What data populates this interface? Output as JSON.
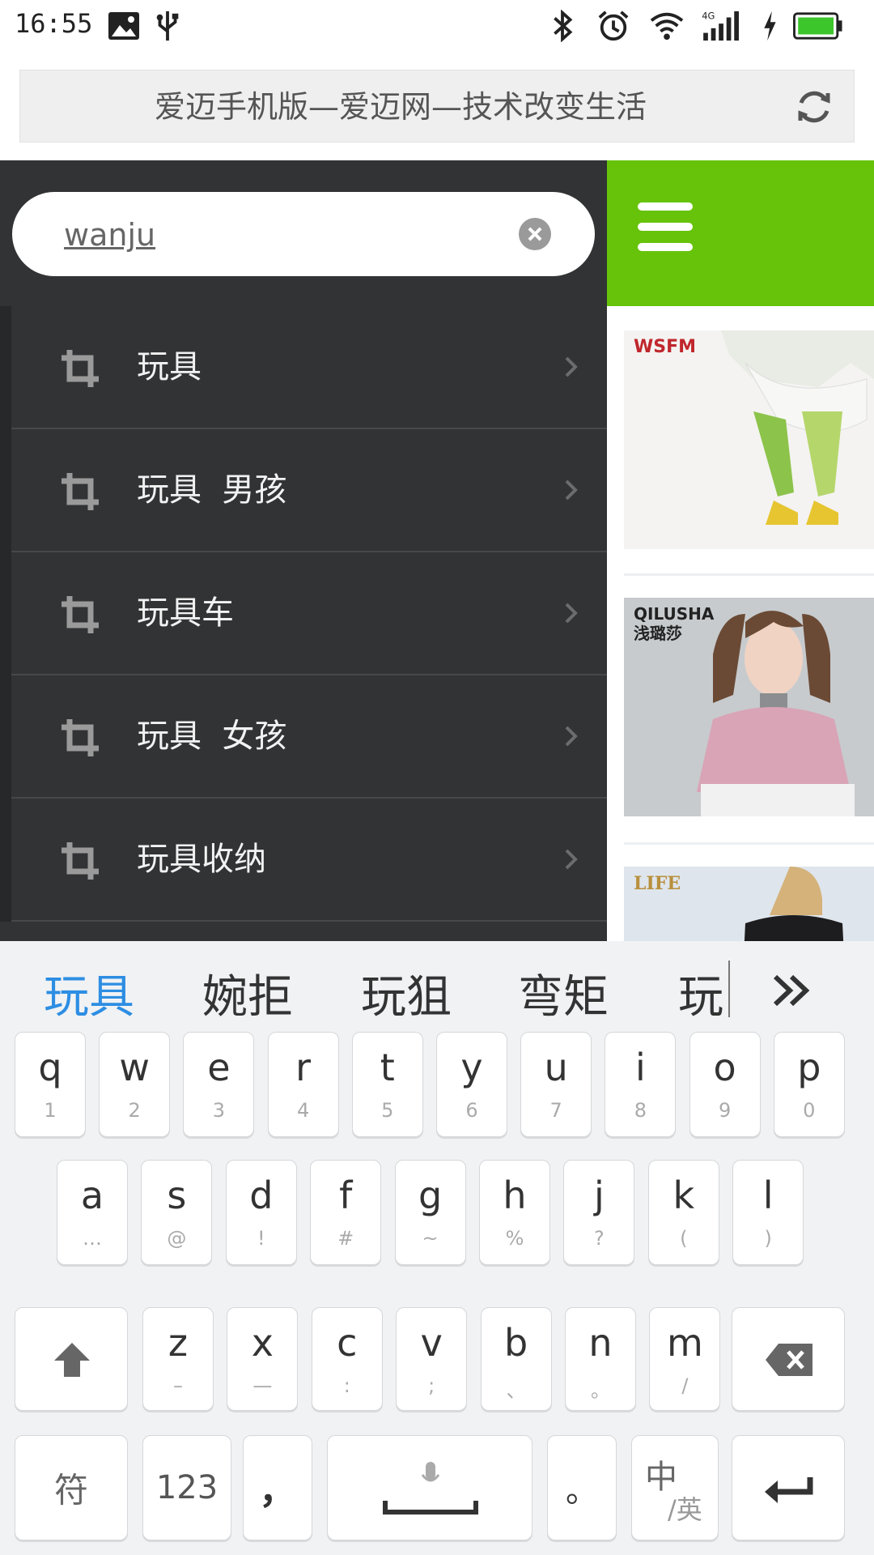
{
  "status_bar": {
    "time": "16:55",
    "battery_color": "#3dc52c"
  },
  "url_bar": {
    "title": "爱迈手机版—爱迈网—技术改变生活"
  },
  "search": {
    "value": "wanju"
  },
  "suggestions": [
    {
      "label": "玩具"
    },
    {
      "label": "玩具  男孩"
    },
    {
      "label": "玩具车"
    },
    {
      "label": "玩具  女孩"
    },
    {
      "label": "玩具收纳"
    }
  ],
  "products": [
    {
      "brand": "WSFM"
    },
    {
      "brand": "QILUSHA 浅璐莎"
    },
    {
      "brand": "LIFE"
    }
  ],
  "keyboard": {
    "candidates": [
      "玩具",
      "婉拒",
      "玩狙",
      "弯矩",
      "玩"
    ],
    "candidate_more": "»",
    "row1": [
      {
        "k": "q",
        "s": "1"
      },
      {
        "k": "w",
        "s": "2"
      },
      {
        "k": "e",
        "s": "3"
      },
      {
        "k": "r",
        "s": "4"
      },
      {
        "k": "t",
        "s": "5"
      },
      {
        "k": "y",
        "s": "6"
      },
      {
        "k": "u",
        "s": "7"
      },
      {
        "k": "i",
        "s": "8"
      },
      {
        "k": "o",
        "s": "9"
      },
      {
        "k": "p",
        "s": "0"
      }
    ],
    "row2": [
      {
        "k": "a",
        "s": "…"
      },
      {
        "k": "s",
        "s": "@"
      },
      {
        "k": "d",
        "s": "!"
      },
      {
        "k": "f",
        "s": "#"
      },
      {
        "k": "g",
        "s": "~"
      },
      {
        "k": "h",
        "s": "%"
      },
      {
        "k": "j",
        "s": "?"
      },
      {
        "k": "k",
        "s": "("
      },
      {
        "k": "l",
        "s": ")"
      }
    ],
    "row3": [
      {
        "k": "z",
        "s": "–"
      },
      {
        "k": "x",
        "s": "—"
      },
      {
        "k": "c",
        "s": ":"
      },
      {
        "k": "v",
        "s": ";"
      },
      {
        "k": "b",
        "s": "、"
      },
      {
        "k": "n",
        "s": "。"
      },
      {
        "k": "m",
        "s": "/"
      }
    ],
    "symbol_key": "符",
    "num_key": "123",
    "comma_key": "，",
    "period_key": "。",
    "lang_key_main": "中",
    "lang_key_sub": "/英"
  }
}
